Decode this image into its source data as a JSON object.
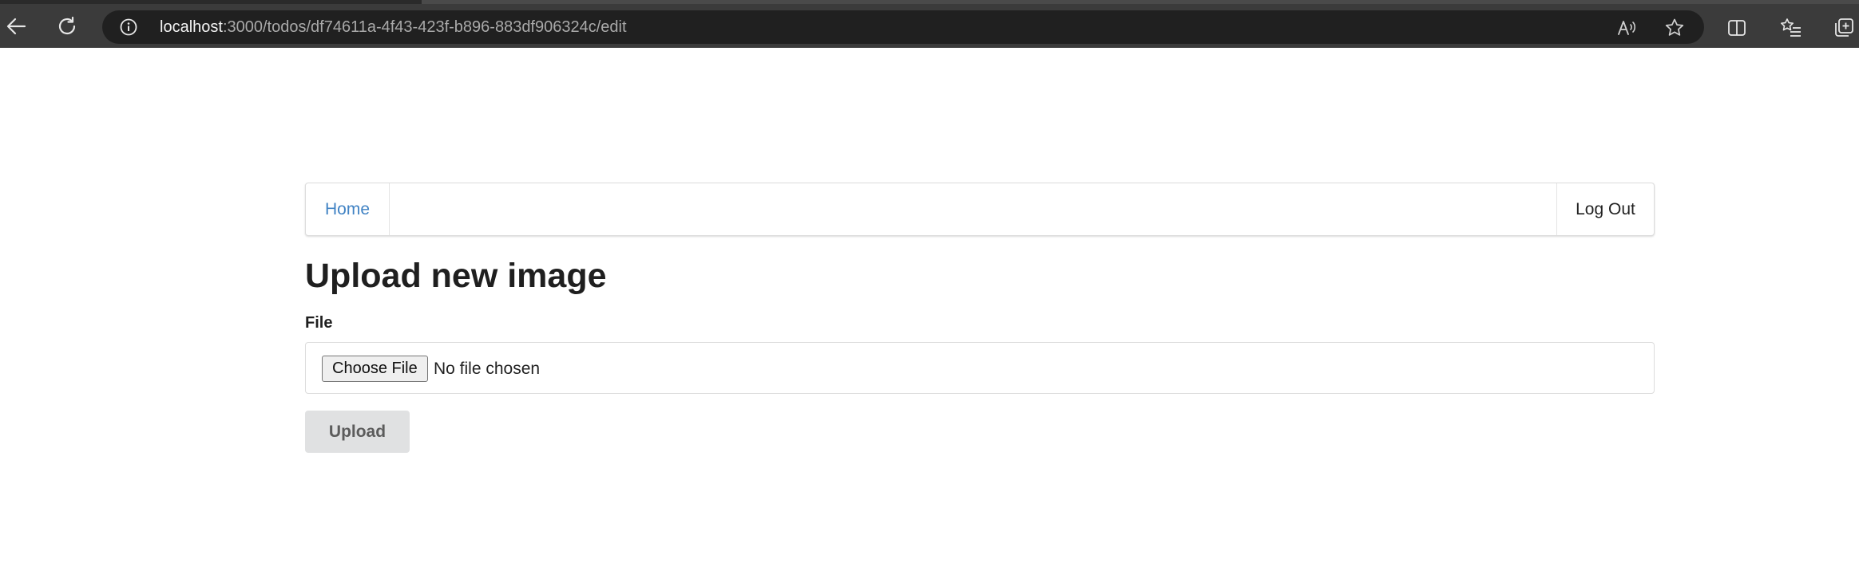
{
  "browser": {
    "url_host": "localhost",
    "url_rest": ":3000/todos/df74611a-4f43-423f-b896-883df906324c/edit",
    "icons": {
      "back": "back-arrow-icon",
      "reload": "reload-icon",
      "site_info": "info-icon",
      "read_aloud": "read-aloud-icon",
      "favorite": "star-icon",
      "split_screen": "split-screen-icon",
      "favorites": "favorites-list-icon",
      "collections": "collections-icon"
    }
  },
  "navbar": {
    "home_label": "Home",
    "logout_label": "Log Out",
    "link_color": "#4183c4"
  },
  "form": {
    "title": "Upload new image",
    "file_label": "File",
    "choose_file_label": "Choose File",
    "file_status": "No file chosen",
    "upload_label": "Upload"
  }
}
